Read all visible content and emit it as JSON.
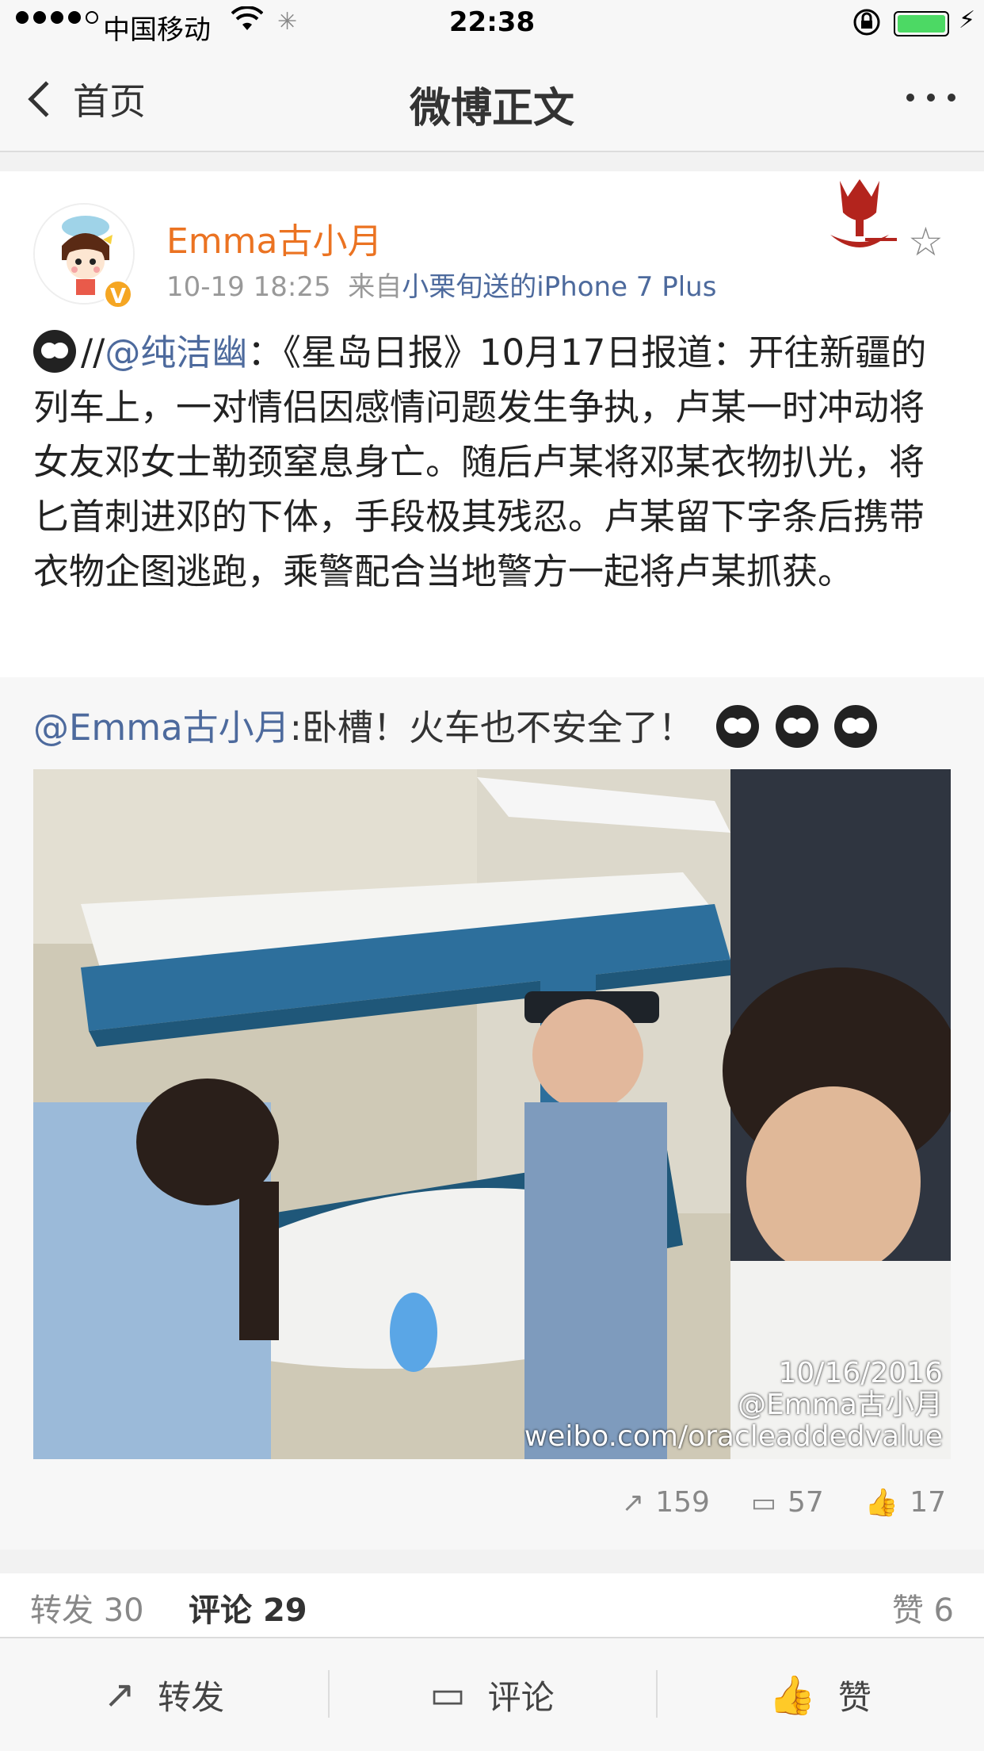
{
  "status_bar": {
    "carrier": "中国移动",
    "time": "22:38"
  },
  "nav": {
    "back_label": "首页",
    "title": "微博正文"
  },
  "post": {
    "username": "Emma古小月",
    "time": "10-19 18:25",
    "source_prefix": "来自",
    "source": "小栗旬送的iPhone 7 Plus",
    "text_prefix": "//",
    "mention": "@纯洁幽",
    "text": "：《星岛日报》10月17日报道：开往新疆的列车上，一对情侣因感情问题发生争执，卢某一时冲动将女友邓女士勒颈窒息身亡。随后卢某将邓某衣物扒光，将匕首刺进邓的下体，手段极其残忍。卢某留下字条后携带衣物企图逃跑，乘警配合当地警方一起将卢某抓获。"
  },
  "retweet": {
    "mention": "@Emma古小月",
    "text": ":卧槽！火车也不安全了！",
    "watermark_date": "10/16/2016",
    "watermark_user": "@Emma古小月",
    "watermark_url": "weibo.com/oracleaddedvalue",
    "reposts": "159",
    "comments": "57",
    "likes": "17"
  },
  "tabs": {
    "repost_label": "转发",
    "repost_count": "30",
    "comment_label": "评论",
    "comment_count": "29",
    "like_label": "赞",
    "like_count": "6"
  },
  "toolbar": {
    "repost": "转发",
    "comment": "评论",
    "like": "赞"
  },
  "colors": {
    "username": "#eb7322",
    "link": "#4d6a9d"
  }
}
